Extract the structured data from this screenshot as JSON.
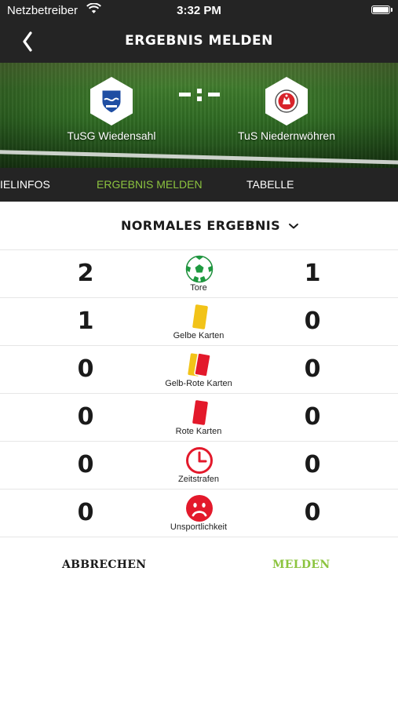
{
  "status_bar": {
    "carrier": "Netzbetreiber",
    "time": "3:32 PM"
  },
  "nav": {
    "title": "ERGEBNIS MELDEN",
    "back_icon": "chevron-left-icon"
  },
  "match": {
    "home_team": "TuSG Wiedensahl",
    "away_team": "TuS Niedernwöhren",
    "score_placeholder": "-:-"
  },
  "tabs": [
    {
      "label": "IELINFOS",
      "active": false
    },
    {
      "label": "ERGEBNIS MELDEN",
      "active": true
    },
    {
      "label": "TABELLE",
      "active": false
    }
  ],
  "result_type": {
    "label": "NORMALES ERGEBNIS",
    "icon": "chevron-down-icon"
  },
  "stats": [
    {
      "label": "Tore",
      "home": "2",
      "away": "1",
      "icon": "football-icon"
    },
    {
      "label": "Gelbe Karten",
      "home": "1",
      "away": "0",
      "icon": "yellow-card-icon"
    },
    {
      "label": "Gelb-Rote Karten",
      "home": "0",
      "away": "0",
      "icon": "yellow-red-card-icon"
    },
    {
      "label": "Rote Karten",
      "home": "0",
      "away": "0",
      "icon": "red-card-icon"
    },
    {
      "label": "Zeitstrafen",
      "home": "0",
      "away": "0",
      "icon": "clock-icon"
    },
    {
      "label": "Unsportlichkeit",
      "home": "0",
      "away": "0",
      "icon": "sad-face-icon"
    }
  ],
  "actions": {
    "cancel": "ABBRECHEN",
    "submit": "MELDEN"
  },
  "colors": {
    "bar": "#242424",
    "accent": "#8cc43f",
    "red": "#e3192b",
    "yellow": "#f2c318",
    "green": "#23a047"
  }
}
